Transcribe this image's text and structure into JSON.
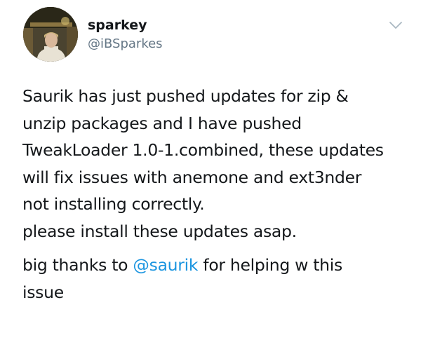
{
  "author": {
    "display_name": "sparkey",
    "handle": "@iBSparkes"
  },
  "icons": {
    "avatar": "profile-photo",
    "caret": "chevron-down-icon"
  },
  "colors": {
    "text": "#14171a",
    "secondary": "#657786",
    "link": "#1b95e0"
  },
  "tweet": {
    "lines": [
      "Saurik has just pushed updates for zip &",
      "unzip packages and I have pushed",
      "TweakLoader 1.0-1.combined, these updates",
      "will fix issues with anemone and ext3nder",
      "not installing correctly.",
      "please install these updates asap."
    ],
    "thanks_prefix": "big thanks to ",
    "mention": "@saurik",
    "thanks_suffix": " for helping w this",
    "thanks_line2": "issue"
  }
}
